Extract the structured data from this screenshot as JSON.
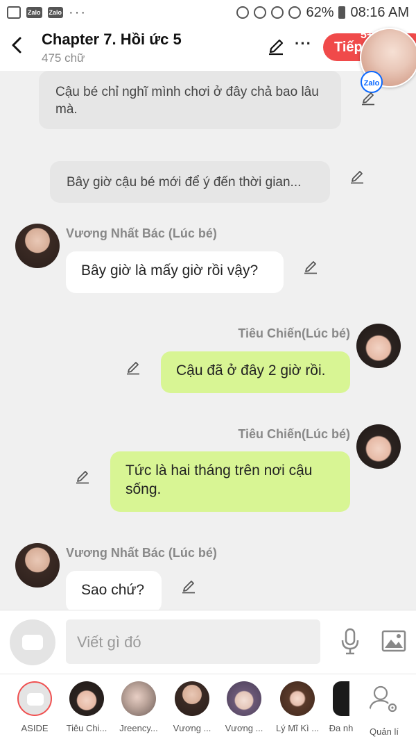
{
  "status_bar": {
    "zalo_1": "Zalo",
    "zalo_2": "Zalo",
    "dots": "···",
    "battery": "62%",
    "time": "08:16 AM"
  },
  "header": {
    "title": "Chapter 7. Hồi ức 5",
    "subtitle": "475 chữ",
    "more": "···",
    "next_label": "Tiếp",
    "next_badge": "5+",
    "zalo_logo": "Zalo"
  },
  "chat": {
    "narration": [
      {
        "text": "Cậu bé chỉ nghĩ mình chơi ở đây chả bao lâu mà."
      },
      {
        "text": "Bây giờ cậu bé mới để ý đến thời gian..."
      }
    ],
    "messages": [
      {
        "sender": "Vương Nhất Bác (Lúc bé)",
        "text": "Bây giờ là mấy giờ rồi vậy?",
        "side": "left"
      },
      {
        "sender": "Tiêu Chiến(Lúc bé)",
        "text": "Cậu đã ở đây 2 giờ rồi.",
        "side": "right"
      },
      {
        "sender": "Tiêu Chiến(Lúc bé)",
        "text": "Tức là hai tháng trên nơi cậu sống.",
        "side": "right"
      },
      {
        "sender": "Vương Nhất Bác (Lúc bé)",
        "text": "Sao chứ?",
        "side": "left"
      }
    ]
  },
  "input": {
    "placeholder": "Viết gì đó"
  },
  "characters": [
    {
      "label": "ASIDE"
    },
    {
      "label": "Tiêu Chi..."
    },
    {
      "label": "Jreency..."
    },
    {
      "label": "Vương ..."
    },
    {
      "label": "Vương ..."
    },
    {
      "label": "Lý Mĩ Kì ..."
    },
    {
      "label": "Đa nh"
    },
    {
      "label": "Quản lí"
    }
  ],
  "colors": {
    "accent_red": "#f04a4a",
    "bubble_green": "#d8f594",
    "narration_gray": "#e6e6e6"
  }
}
